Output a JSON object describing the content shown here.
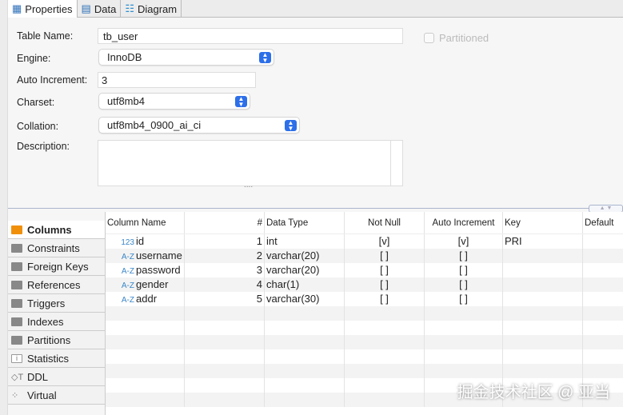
{
  "tabs": [
    {
      "label": "Properties",
      "icon": "table-icon"
    },
    {
      "label": "Data",
      "icon": "data-icon"
    },
    {
      "label": "Diagram",
      "icon": "diagram-icon"
    }
  ],
  "form": {
    "table_name_label": "Table Name:",
    "table_name": "tb_user",
    "partitioned_label": "Partitioned",
    "engine_label": "Engine:",
    "engine": "InnoDB",
    "auto_inc_label": "Auto Increment:",
    "auto_inc": "3",
    "charset_label": "Charset:",
    "charset": "utf8mb4",
    "collation_label": "Collation:",
    "collation": "utf8mb4_0900_ai_ci",
    "description_label": "Description:",
    "description": "",
    "resize_handle": "...."
  },
  "side_tabs": [
    "Columns",
    "Constraints",
    "Foreign Keys",
    "References",
    "Triggers",
    "Indexes",
    "Partitions",
    "Statistics",
    "DDL",
    "Virtual"
  ],
  "columns_header": [
    "Column Name",
    "#",
    "Data Type",
    "Not Null",
    "Auto Increment",
    "Key",
    "Default"
  ],
  "rows": [
    {
      "icon": "123",
      "name": "id",
      "num": "1",
      "type": "int",
      "notnull": "[v]",
      "autoinc": "[v]",
      "key": "PRI",
      "default": ""
    },
    {
      "icon": "A-Z",
      "name": "username",
      "num": "2",
      "type": "varchar(20)",
      "notnull": "[ ]",
      "autoinc": "[ ]",
      "key": "",
      "default": ""
    },
    {
      "icon": "A-Z",
      "name": "password",
      "num": "3",
      "type": "varchar(20)",
      "notnull": "[ ]",
      "autoinc": "[ ]",
      "key": "",
      "default": ""
    },
    {
      "icon": "A-Z",
      "name": "gender",
      "num": "4",
      "type": "char(1)",
      "notnull": "[ ]",
      "autoinc": "[ ]",
      "key": "",
      "default": ""
    },
    {
      "icon": "A-Z",
      "name": "addr",
      "num": "5",
      "type": "varchar(30)",
      "notnull": "[ ]",
      "autoinc": "[ ]",
      "key": "",
      "default": ""
    }
  ],
  "watermark": "掘金技术社区 @ 亚当"
}
